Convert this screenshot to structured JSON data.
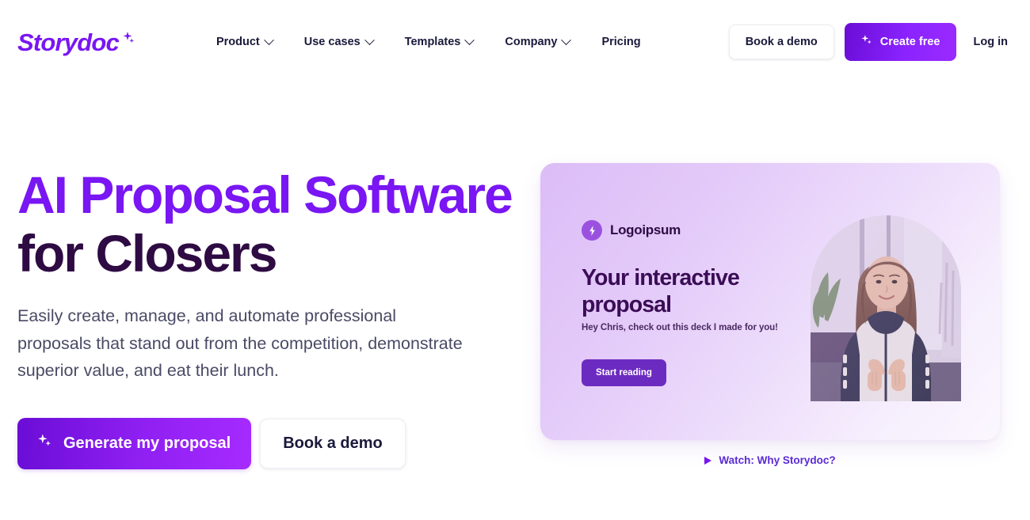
{
  "brand": {
    "name": "Storydoc",
    "logo_icon": "sparkles-icon",
    "primary": "#7916F3",
    "dark": "#2E0B43",
    "text": "#19193B"
  },
  "nav": {
    "items": [
      {
        "label": "Product",
        "has_dropdown": true,
        "icon": "chevron-down-icon"
      },
      {
        "label": "Use cases",
        "has_dropdown": true,
        "icon": "chevron-down-icon"
      },
      {
        "label": "Templates",
        "has_dropdown": true,
        "icon": "chevron-down-icon"
      },
      {
        "label": "Company",
        "has_dropdown": true,
        "icon": "chevron-down-icon"
      },
      {
        "label": "Pricing",
        "has_dropdown": false,
        "icon": ""
      }
    ],
    "book_demo_label": "Book a demo",
    "create_free_label": "Create free",
    "create_free_icon": "sparkles-icon",
    "login_label": "Log in"
  },
  "hero": {
    "title_line1": "AI Proposal Software",
    "title_line2": "for Closers",
    "subtitle": "Easily create, manage, and automate professional proposals that stand out from the competition, demonstrate superior value, and eat their lunch.",
    "primary_cta": "Generate my proposal",
    "primary_cta_icon": "sparkles-icon",
    "secondary_cta": "Book a demo"
  },
  "deck_preview": {
    "logo_text": "Logoipsum",
    "logo_icon": "lightning-bolt-icon",
    "title": "Your interactive proposal",
    "subtitle": "Hey Chris, check out this deck I made for you!",
    "button_label": "Start reading",
    "photo_alt": "smiling-woman-making-heart-gesture"
  },
  "watch_link": {
    "icon": "play-triangle-icon",
    "label": "Watch: Why Storydoc?"
  }
}
